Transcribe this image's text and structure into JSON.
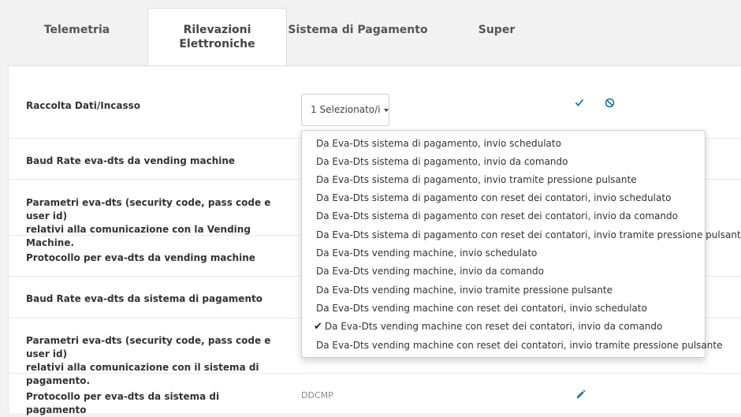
{
  "tabs": [
    {
      "label": "Telemetria"
    },
    {
      "label": "Rilevazioni\nElettroniche"
    },
    {
      "label": "Sistema di Pagamento"
    },
    {
      "label": "Super"
    }
  ],
  "rows": [
    {
      "label": "Raccolta Dati/Incasso"
    },
    {
      "label": "Baud Rate eva-dts da vending machine"
    },
    {
      "label_line1": "Parametri eva-dts (security code, pass code e user id)",
      "label_line2": "relativi alla comunicazione con la Vending Machine."
    },
    {
      "label": "Protocollo per eva-dts da vending machine"
    },
    {
      "label": "Baud Rate eva-dts da sistema di pagamento"
    },
    {
      "label_line1": "Parametri eva-dts (security code, pass code e user id)",
      "label_line2": "relativi alla comunicazione con il sistema di pagamento."
    },
    {
      "label": "Protocollo per eva-dts da sistema di pagamento",
      "value": "DDCMP"
    }
  ],
  "select": {
    "label": "1 Selezionato/i"
  },
  "icons": {
    "confirm": "check-icon",
    "cancel": "ban-icon",
    "edit": "pencil-icon"
  },
  "colors": {
    "accent": "#1a73b5"
  },
  "options": [
    {
      "label": "Da Eva-Dts sistema di pagamento, invio schedulato",
      "checked": false
    },
    {
      "label": "Da Eva-Dts sistema di pagamento, invio da comando",
      "checked": false
    },
    {
      "label": "Da Eva-Dts sistema di pagamento, invio tramite pressione pulsante",
      "checked": false
    },
    {
      "label": "Da Eva-Dts sistema di pagamento con reset dei contatori, invio schedulato",
      "checked": false
    },
    {
      "label": "Da Eva-Dts sistema di pagamento con reset dei contatori, invio da comando",
      "checked": false
    },
    {
      "label": "Da Eva-Dts sistema di pagamento con reset dei contatori, invio tramite pressione pulsante",
      "checked": false
    },
    {
      "label": "Da Eva-Dts vending machine, invio schedulato",
      "checked": false
    },
    {
      "label": "Da Eva-Dts vending machine, invio da comando",
      "checked": false
    },
    {
      "label": "Da Eva-Dts vending machine, invio tramite pressione pulsante",
      "checked": false
    },
    {
      "label": "Da Eva-Dts vending machine con reset dei contatori, invio schedulato",
      "checked": false
    },
    {
      "label": "Da Eva-Dts vending machine con reset dei contatori, invio da comando",
      "checked": true
    },
    {
      "label": "Da Eva-Dts vending machine con reset dei contatori, invio tramite pressione pulsante",
      "checked": false
    }
  ]
}
